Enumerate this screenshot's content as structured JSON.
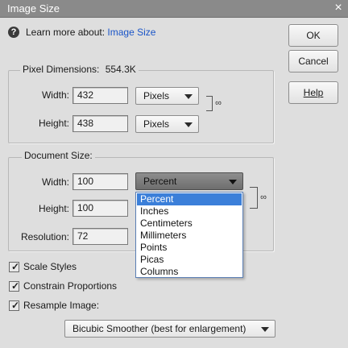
{
  "window": {
    "title": "Image Size",
    "close_icon": "×"
  },
  "learn_more": {
    "prefix": "Learn more about:",
    "link": "Image Size",
    "icon": "?"
  },
  "buttons": {
    "ok": "OK",
    "cancel": "Cancel",
    "help": "Help"
  },
  "pixel_dimensions": {
    "title": "Pixel Dimensions:",
    "size": "554.3K",
    "width_label": "Width:",
    "width_value": "432",
    "width_unit": "Pixels",
    "height_label": "Height:",
    "height_value": "438",
    "height_unit": "Pixels"
  },
  "document_size": {
    "title": "Document Size:",
    "width_label": "Width:",
    "width_value": "100",
    "width_unit": "Percent",
    "height_label": "Height:",
    "height_value": "100",
    "resolution_label": "Resolution:",
    "resolution_value": "72"
  },
  "unit_dropdown": {
    "options": [
      "Percent",
      "Inches",
      "Centimeters",
      "Millimeters",
      "Points",
      "Picas",
      "Columns"
    ],
    "selected": "Percent"
  },
  "options": {
    "scale_styles": {
      "label": "Scale Styles",
      "checked": true
    },
    "constrain_proportions": {
      "label": "Constrain Proportions",
      "checked": true
    },
    "resample_image": {
      "label": "Resample Image:",
      "checked": true
    }
  },
  "resample_method": {
    "value": "Bicubic Smoother (best for enlargement)"
  },
  "colors": {
    "title_bar": "#8a8a8a",
    "dialog_bg": "#dedede",
    "link": "#1a55c8",
    "selection": "#3b7fd9"
  }
}
